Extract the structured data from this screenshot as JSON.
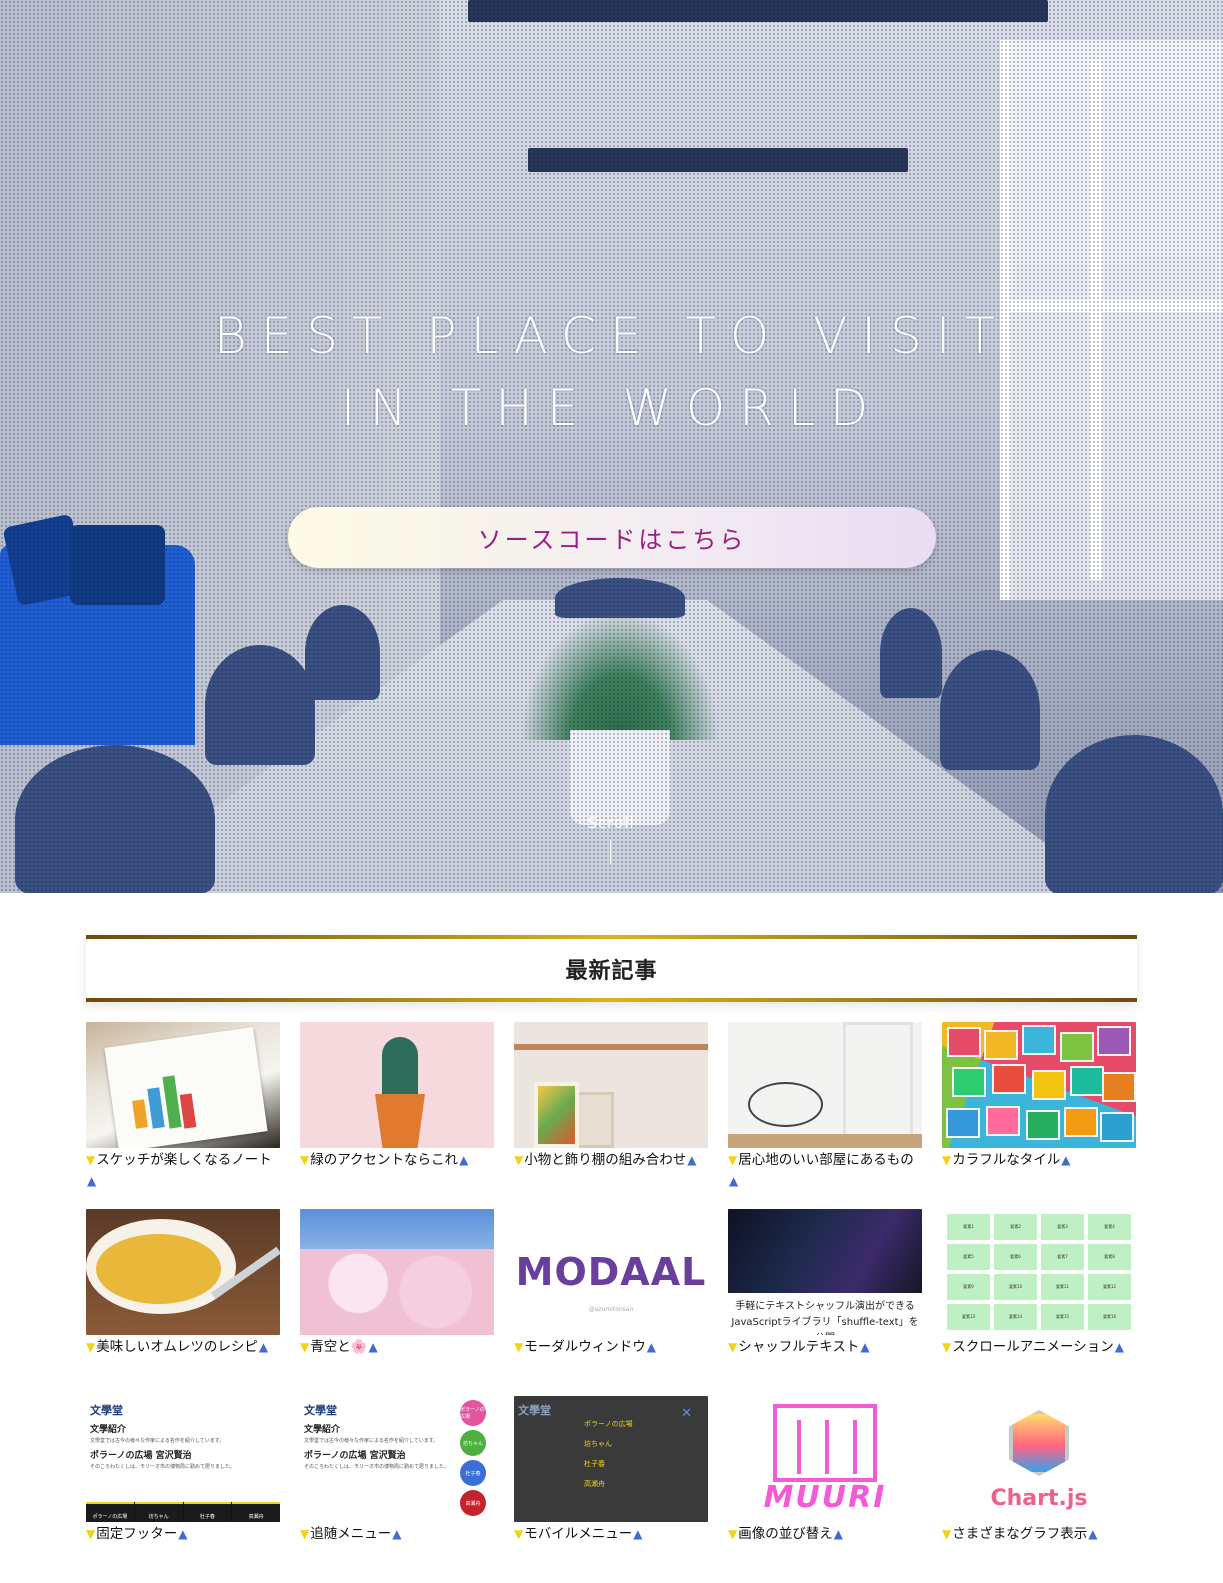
{
  "hero": {
    "title_line1": "BEST PLACE TO VISIT",
    "title_line2": "IN THE WORLD",
    "cta_label": "ソースコードはこちら",
    "scroll_label": "Scroll"
  },
  "section": {
    "title": "最新記事"
  },
  "articles": [
    {
      "title": "スケッチが楽しくなるノート"
    },
    {
      "title": "緑のアクセントならこれ"
    },
    {
      "title": "小物と飾り棚の組み合わせ"
    },
    {
      "title": "居心地のいい部屋にあるもの"
    },
    {
      "title": "カラフルなタイル"
    },
    {
      "title": "美味しいオムレツのレシピ"
    },
    {
      "title": "青空と🌸"
    },
    {
      "title": "モーダルウィンドウ"
    },
    {
      "title": "シャッフルテキスト"
    },
    {
      "title": "スクロールアニメーション"
    },
    {
      "title": "固定フッター"
    },
    {
      "title": "追随メニュー"
    },
    {
      "title": "モバイルメニュー"
    },
    {
      "title": "画像の並び替え"
    },
    {
      "title": "さまざまなグラフ表示"
    }
  ],
  "thumb_text": {
    "modaal_logo": "MODAAL",
    "modaal_sub": "@azumitonsan",
    "shuffle_line1": "手軽にテキストシャッフル演出ができる",
    "shuffle_line2": "JavaScriptライブラリ「shuffle-text」を公開",
    "scroll_cells": [
      "要素1",
      "要素2",
      "要素3",
      "要素4",
      "要素5",
      "要素6",
      "要素7",
      "要素8",
      "要素9",
      "要素10",
      "要素11",
      "要素12",
      "要素13",
      "要素14",
      "要素15",
      "要素16"
    ],
    "doc_h1": "文學堂",
    "doc_h2a": "文學紹介",
    "doc_p1": "文學堂では古今の様々な作家による名作を紹介しています。",
    "doc_h2b": "ポラーノの広場 宮沢賢治",
    "doc_p2": "そのころわたくしは、モリーオ市の博物局に勤めて居りました。",
    "footer_items": [
      "ポラーノの広場",
      "坊ちゃん",
      "杜子春",
      "高瀬舟"
    ],
    "follow_items": [
      "ポラーノの広場",
      "坊ちゃん",
      "杜子春",
      "高瀬舟"
    ],
    "mobile_menu": [
      "ポラーノの広場",
      "坊ちゃん",
      "杜子春",
      "高瀬舟"
    ],
    "muuri_word": "MUURI",
    "chartjs_word": "Chart.js"
  },
  "colors": {
    "cta_text": "#9b1d86",
    "marker_down": "#f1d418",
    "marker_up": "#3f6ad8"
  },
  "icons": {
    "marker_down": "triangle-down-icon",
    "marker_up": "triangle-up-icon",
    "close": "close-icon"
  }
}
